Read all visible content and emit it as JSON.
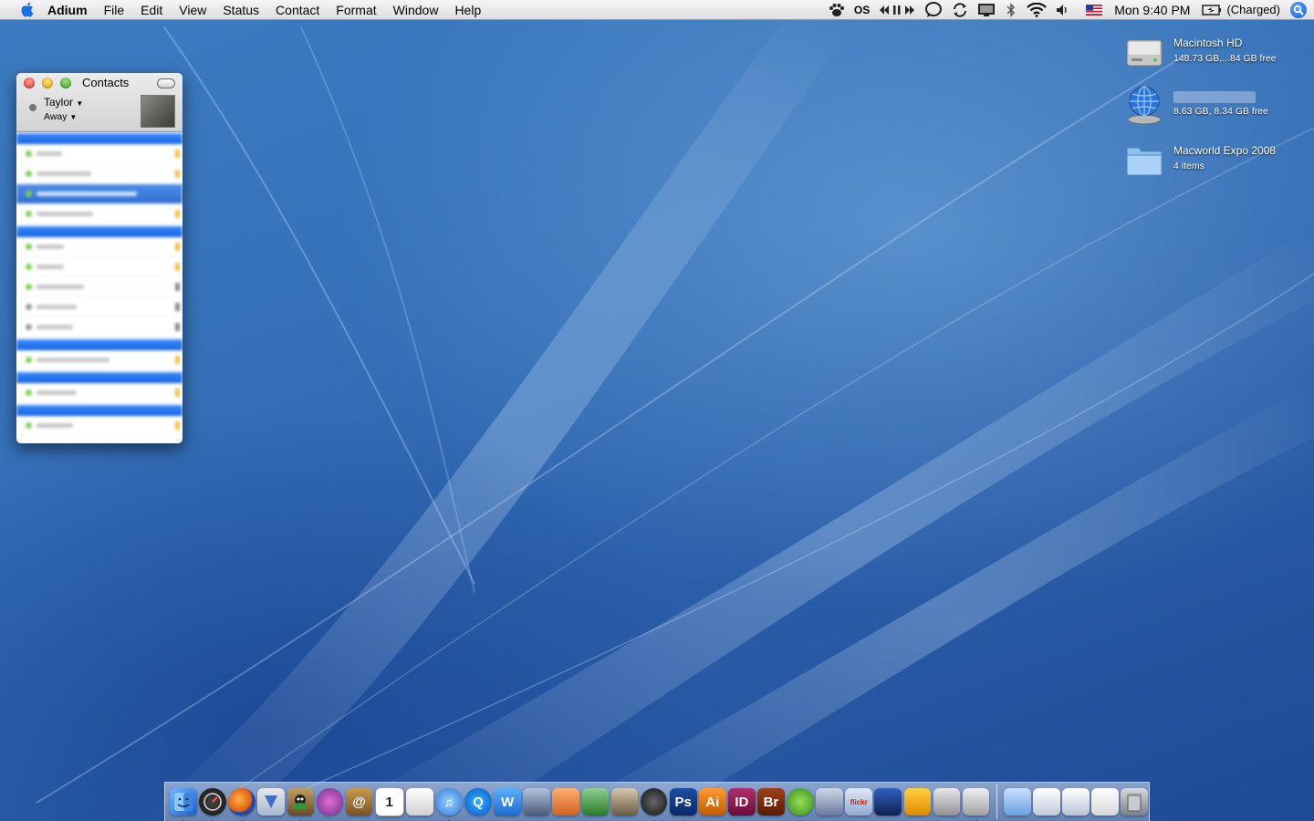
{
  "menubar": {
    "app_name": "Adium",
    "menus": [
      "File",
      "Edit",
      "View",
      "Status",
      "Contact",
      "Format",
      "Window",
      "Help"
    ],
    "clock": "Mon 9:40 PM",
    "battery_status": "(Charged)",
    "status_icons": [
      "growl-paw-icon",
      "os-text-icon",
      "media-controls-icon",
      "chat-bubble-icon",
      "sync-icon",
      "display-icon",
      "bluetooth-icon",
      "wifi-icon",
      "volume-icon",
      "us-flag-icon",
      "battery-icon",
      "spotlight-icon"
    ],
    "os_text": "OS"
  },
  "desktop_icons": [
    {
      "name": "Macintosh HD",
      "sub": "148.73 GB,...84 GB free",
      "icon": "hard-drive-icon"
    },
    {
      "name": "",
      "sub": "8.63 GB, 8.34 GB free",
      "icon": "network-disk-icon"
    },
    {
      "name": "Macworld Expo 2008",
      "sub": "4 items",
      "icon": "folder-icon"
    }
  ],
  "contacts_window": {
    "title": "Contacts",
    "user_name": "Taylor",
    "user_status": "Away"
  },
  "dock": {
    "text_tiles": {
      "photoshop": "Ps",
      "illustrator": "Ai",
      "indesign": "ID",
      "bridge": "Br",
      "flickr": "flickr"
    }
  },
  "colors": {
    "desktop_blue": "#2f68b0",
    "menubar": "#e8e8e8",
    "group_header_blue": "#1f6fe8",
    "status_available": "#7ccf50"
  }
}
